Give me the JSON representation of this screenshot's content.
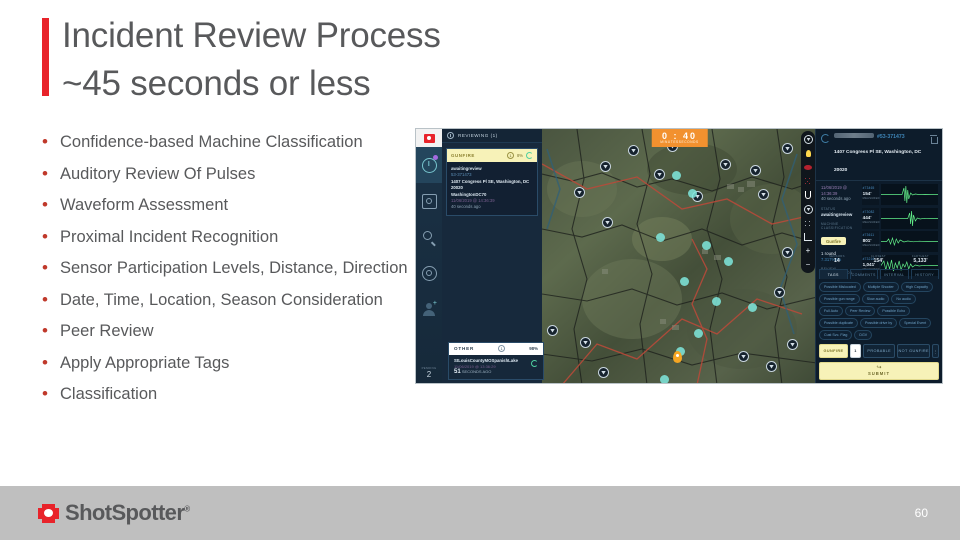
{
  "slide": {
    "title_line1": "Incident Review Process",
    "title_line2": "~45 seconds or less",
    "accent_color": "#e8232a",
    "text_color": "#58595b",
    "page_number": "60"
  },
  "bullets": [
    {
      "text": "Confidence-based Machine Classification"
    },
    {
      "text": "Auditory Review Of Pulses"
    },
    {
      "text": "Waveform Assessment"
    },
    {
      "text": "Proximal Incident Recognition"
    },
    {
      "text": "Sensor Participation Levels, Distance, Direction"
    },
    {
      "text": "Date, Time, Location, Season Consideration"
    },
    {
      "text": "Peer Review"
    },
    {
      "text": "Apply Appropriate Tags"
    },
    {
      "text": "Classification"
    }
  ],
  "footer": {
    "brand": "ShotSpotter",
    "trademark": "®",
    "bg_color": "#bfbfbf"
  },
  "app": {
    "rail": {
      "items": [
        {
          "name": "alerts-icon",
          "badge": "dot"
        },
        {
          "name": "target-icon",
          "badge": ""
        },
        {
          "name": "search-icon",
          "badge": ""
        },
        {
          "name": "settings-icon",
          "badge": ""
        },
        {
          "name": "user-icon",
          "badge": "plus"
        }
      ],
      "pending_label": "PENDING",
      "pending_count": "2"
    },
    "review_panel": {
      "header": "REVIEWING (1)",
      "card": {
        "classification": "GUNFIRE",
        "count": "1",
        "confidence": "8%",
        "status": "awaitingreview",
        "incident_id": "53-371473",
        "address_line1": "1407 Congress Pl SE, Washington, DC",
        "address_line2": "20020",
        "sensor_group": "WashingtonDC70",
        "timestamp": "11/06/2019 @ 14:36:39",
        "age": "40 seconds ago"
      },
      "other_card": {
        "classification": "OTHER",
        "count": "1",
        "confidence": "98%",
        "sensor_group": "StLouisCountyMOSpanishLake",
        "timestamp": "11/06/2019 @ 13:36:29",
        "age_value": "51",
        "age_unit": "SECONDS AGO"
      }
    },
    "map": {
      "timer_minutes": "0",
      "timer_separator": ":",
      "timer_seconds": "40",
      "timer_minutes_label": "MINUTES",
      "timer_seconds_label": "SECONDS",
      "toolbar": [
        {
          "name": "sensor-filter-icon"
        },
        {
          "name": "lightbulb-icon"
        },
        {
          "name": "incident-oval-icon"
        },
        {
          "name": "dot-cluster-icon"
        },
        {
          "name": "trophy-icon"
        },
        {
          "name": "sensor-pin-icon"
        },
        {
          "name": "grid-icon"
        },
        {
          "name": "measure-icon"
        },
        {
          "name": "zoom-in-icon"
        },
        {
          "name": "zoom-out-icon"
        }
      ]
    },
    "detail": {
      "incident_id": "#53-371473",
      "address": "1407 Congress Pl SE, Washington, DC 20020",
      "timestamp": "11/06/2019 @ 14:36:39",
      "age": "40 seconds ago",
      "status_label": "STATUS",
      "status_value": "awaitingreview",
      "machine_label": "MACHINE CLASSIFICATION",
      "machine_chip": "Gunfire",
      "rounds": "1 round",
      "confidence": "7.317%3%",
      "review_label": "REVIEW CLASSIFICATION",
      "waveforms": [
        {
          "sensor_id": "#73465",
          "distance": "154'",
          "unit": "MEASURED"
        },
        {
          "sensor_id": "#73082",
          "distance": "444'",
          "unit": "MEASURED"
        },
        {
          "sensor_id": "#73611",
          "distance": "801'",
          "unit": "MEASURED"
        },
        {
          "sensor_id": "#73216",
          "distance": "1,041'",
          "unit": "MEASURED"
        }
      ],
      "stats": [
        {
          "label": "SENSORS",
          "value": "14"
        },
        {
          "label": "CLOSEST",
          "value": "154'"
        },
        {
          "label": "FARTHEST",
          "value": "5,133'"
        }
      ],
      "tabs": [
        {
          "label": "TAGS",
          "active": true
        },
        {
          "label": "COMMENTS",
          "active": false
        },
        {
          "label": "INTERVAL",
          "active": false
        },
        {
          "label": "HISTORY",
          "active": false
        }
      ],
      "tags": [
        "Possible Mislocated",
        "Multiple Shooter",
        "High Capacity",
        "Possible gun range",
        "Slow audio",
        "No audio",
        "Full Auto",
        "Peer Review",
        "Possible Echo",
        "Possible duplicate",
        "Possible drive by",
        "Special Event",
        "Cust Svc. Flag",
        "DGV"
      ],
      "actions": {
        "gunfire": "GUNFIRE",
        "count": "1",
        "probable": "PROBABLE",
        "not_gunfire": "NOT GUNFIRE",
        "kebab": "⋮"
      },
      "submit_label": "SUBMIT"
    }
  }
}
